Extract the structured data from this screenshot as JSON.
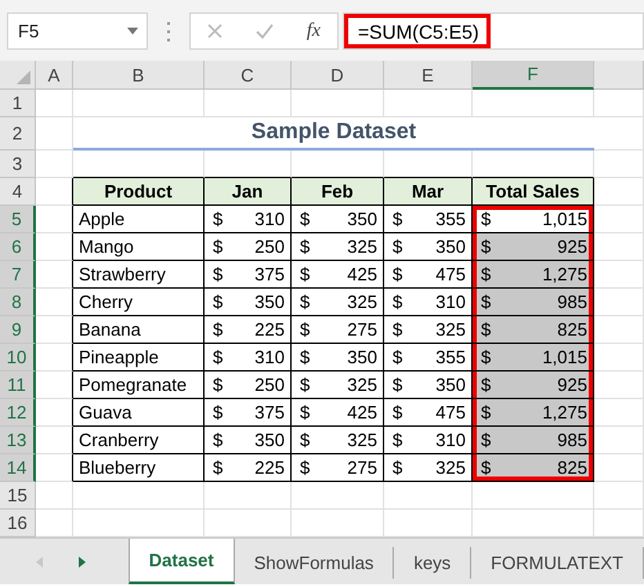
{
  "formula_bar": {
    "name_box": "F5",
    "function_label": "fx",
    "formula": "=SUM(C5:E5)",
    "outlined": true
  },
  "sheet": {
    "columns": [
      {
        "label": "A",
        "selected": false
      },
      {
        "label": "B",
        "selected": false
      },
      {
        "label": "C",
        "selected": false
      },
      {
        "label": "D",
        "selected": false
      },
      {
        "label": "E",
        "selected": false
      },
      {
        "label": "F",
        "selected": true
      }
    ],
    "row_numbers": [
      {
        "label": "1",
        "selected": false
      },
      {
        "label": "2",
        "selected": false
      },
      {
        "label": "3",
        "selected": false
      },
      {
        "label": "4",
        "selected": false
      },
      {
        "label": "5",
        "selected": true
      },
      {
        "label": "6",
        "selected": true
      },
      {
        "label": "7",
        "selected": true
      },
      {
        "label": "8",
        "selected": true
      },
      {
        "label": "9",
        "selected": true
      },
      {
        "label": "10",
        "selected": true
      },
      {
        "label": "11",
        "selected": true
      },
      {
        "label": "12",
        "selected": true
      },
      {
        "label": "13",
        "selected": true
      },
      {
        "label": "14",
        "selected": true
      },
      {
        "label": "15",
        "selected": false
      },
      {
        "label": "16",
        "selected": false
      }
    ],
    "title": "Sample Dataset",
    "headers": [
      "Product",
      "Jan",
      "Feb",
      "Mar",
      "Total Sales"
    ],
    "rows": [
      {
        "product": "Apple",
        "sales": [
          {
            "currency": "$",
            "amount": "310"
          },
          {
            "currency": "$",
            "amount": "350"
          },
          {
            "currency": "$",
            "amount": "355"
          }
        ],
        "total": {
          "currency": "$",
          "amount": "1,015"
        },
        "active": true,
        "selected": true,
        "outlined": true
      },
      {
        "product": "Mango",
        "sales": [
          {
            "currency": "$",
            "amount": "250"
          },
          {
            "currency": "$",
            "amount": "325"
          },
          {
            "currency": "$",
            "amount": "350"
          }
        ],
        "total": {
          "currency": "$",
          "amount": "925"
        },
        "active": false,
        "selected": true,
        "outlined": true
      },
      {
        "product": "Strawberry",
        "sales": [
          {
            "currency": "$",
            "amount": "375"
          },
          {
            "currency": "$",
            "amount": "425"
          },
          {
            "currency": "$",
            "amount": "475"
          }
        ],
        "total": {
          "currency": "$",
          "amount": "1,275"
        },
        "active": false,
        "selected": true,
        "outlined": true
      },
      {
        "product": "Cherry",
        "sales": [
          {
            "currency": "$",
            "amount": "350"
          },
          {
            "currency": "$",
            "amount": "325"
          },
          {
            "currency": "$",
            "amount": "310"
          }
        ],
        "total": {
          "currency": "$",
          "amount": "985"
        },
        "active": false,
        "selected": true,
        "outlined": true
      },
      {
        "product": "Banana",
        "sales": [
          {
            "currency": "$",
            "amount": "225"
          },
          {
            "currency": "$",
            "amount": "275"
          },
          {
            "currency": "$",
            "amount": "325"
          }
        ],
        "total": {
          "currency": "$",
          "amount": "825"
        },
        "active": false,
        "selected": true,
        "outlined": true
      },
      {
        "product": "Pineapple",
        "sales": [
          {
            "currency": "$",
            "amount": "310"
          },
          {
            "currency": "$",
            "amount": "350"
          },
          {
            "currency": "$",
            "amount": "355"
          }
        ],
        "total": {
          "currency": "$",
          "amount": "1,015"
        },
        "active": false,
        "selected": true,
        "outlined": true
      },
      {
        "product": "Pomegranate",
        "sales": [
          {
            "currency": "$",
            "amount": "250"
          },
          {
            "currency": "$",
            "amount": "325"
          },
          {
            "currency": "$",
            "amount": "350"
          }
        ],
        "total": {
          "currency": "$",
          "amount": "925"
        },
        "active": false,
        "selected": true,
        "outlined": true
      },
      {
        "product": "Guava",
        "sales": [
          {
            "currency": "$",
            "amount": "375"
          },
          {
            "currency": "$",
            "amount": "425"
          },
          {
            "currency": "$",
            "amount": "475"
          }
        ],
        "total": {
          "currency": "$",
          "amount": "1,275"
        },
        "active": false,
        "selected": true,
        "outlined": true
      },
      {
        "product": "Cranberry",
        "sales": [
          {
            "currency": "$",
            "amount": "350"
          },
          {
            "currency": "$",
            "amount": "325"
          },
          {
            "currency": "$",
            "amount": "310"
          }
        ],
        "total": {
          "currency": "$",
          "amount": "985"
        },
        "active": false,
        "selected": true,
        "outlined": true
      },
      {
        "product": "Blueberry",
        "sales": [
          {
            "currency": "$",
            "amount": "225"
          },
          {
            "currency": "$",
            "amount": "275"
          },
          {
            "currency": "$",
            "amount": "325"
          }
        ],
        "total": {
          "currency": "$",
          "amount": "825"
        },
        "active": false,
        "selected": true,
        "outlined": true
      }
    ]
  },
  "sheet_tabs": {
    "prev_disabled": true,
    "next_disabled": false,
    "tabs": [
      {
        "label": "Dataset",
        "selected": true
      },
      {
        "label": "ShowFormulas",
        "selected": false
      },
      {
        "label": "keys",
        "selected": false
      },
      {
        "label": "FORMULATEXT",
        "selected": false
      }
    ]
  }
}
